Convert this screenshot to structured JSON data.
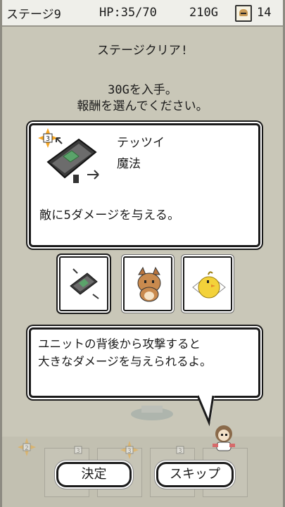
{
  "status": {
    "stage": "ステージ9",
    "hp": "HP:35/70",
    "gold": "210G",
    "count": "14",
    "hero_icon": "hero-face-icon"
  },
  "reward": {
    "title": "ステージクリア!",
    "gold_text": "30Gを入手。",
    "prompt": "報酬を選んでください。"
  },
  "card": {
    "name": "テッツイ",
    "type": "魔法",
    "description": "敵に5ダメージを与える。",
    "badge": "3",
    "art_icon": "iron-hammer-icon"
  },
  "choices": [
    {
      "icon": "iron-hammer-icon",
      "selected": true
    },
    {
      "icon": "cat-unit-icon",
      "selected": false
    },
    {
      "icon": "chick-unit-icon",
      "selected": false
    }
  ],
  "hint": {
    "line1": "ユニットの背後から攻撃すると",
    "line2": "大きなダメージを与えられるよ。"
  },
  "field": {
    "badge1": "2",
    "badge2": "3",
    "badge3": "3",
    "badge4": "3"
  },
  "buttons": {
    "decide": "決定",
    "skip": "スキップ"
  },
  "colors": {
    "background": "#c9c7b8",
    "panel": "#ffffff",
    "outline": "#1b1b1b",
    "badge": "#f5a623"
  }
}
